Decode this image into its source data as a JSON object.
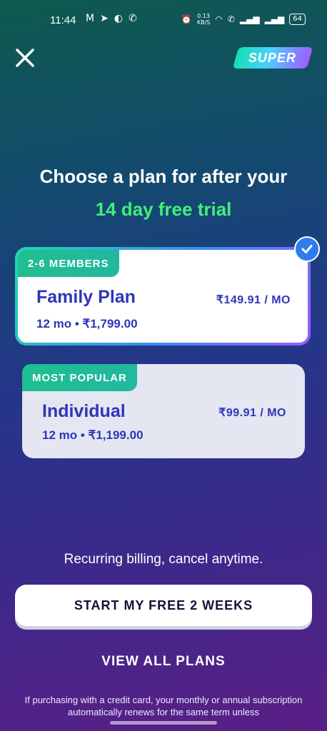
{
  "status_bar": {
    "time": "11:44",
    "net_speed": "0.13\nKB/S",
    "battery": "64"
  },
  "header": {
    "badge": "SUPER"
  },
  "headline": {
    "line1": "Choose a plan for after your",
    "line2": "14 day free trial"
  },
  "plans": [
    {
      "tag": "2-6 MEMBERS",
      "name": "Family Plan",
      "term": "12 mo • ₹1,799.00",
      "price": "₹149.91 / MO",
      "selected": true
    },
    {
      "tag": "MOST POPULAR",
      "name": "Individual",
      "term": "12 mo • ₹1,199.00",
      "price": "₹99.91 / MO",
      "selected": false
    }
  ],
  "recurring_text": "Recurring billing, cancel anytime.",
  "cta_label": "START MY FREE 2 WEEKS",
  "view_all_label": "VIEW ALL PLANS",
  "fine_print": "If purchasing with a credit card, your monthly or annual subscription automatically renews for the same term unless",
  "colors": {
    "accent_green": "#3ff07a",
    "plan_text": "#3035b8",
    "tag_green": "#1fbf8f",
    "check_blue": "#2f7cf0"
  }
}
